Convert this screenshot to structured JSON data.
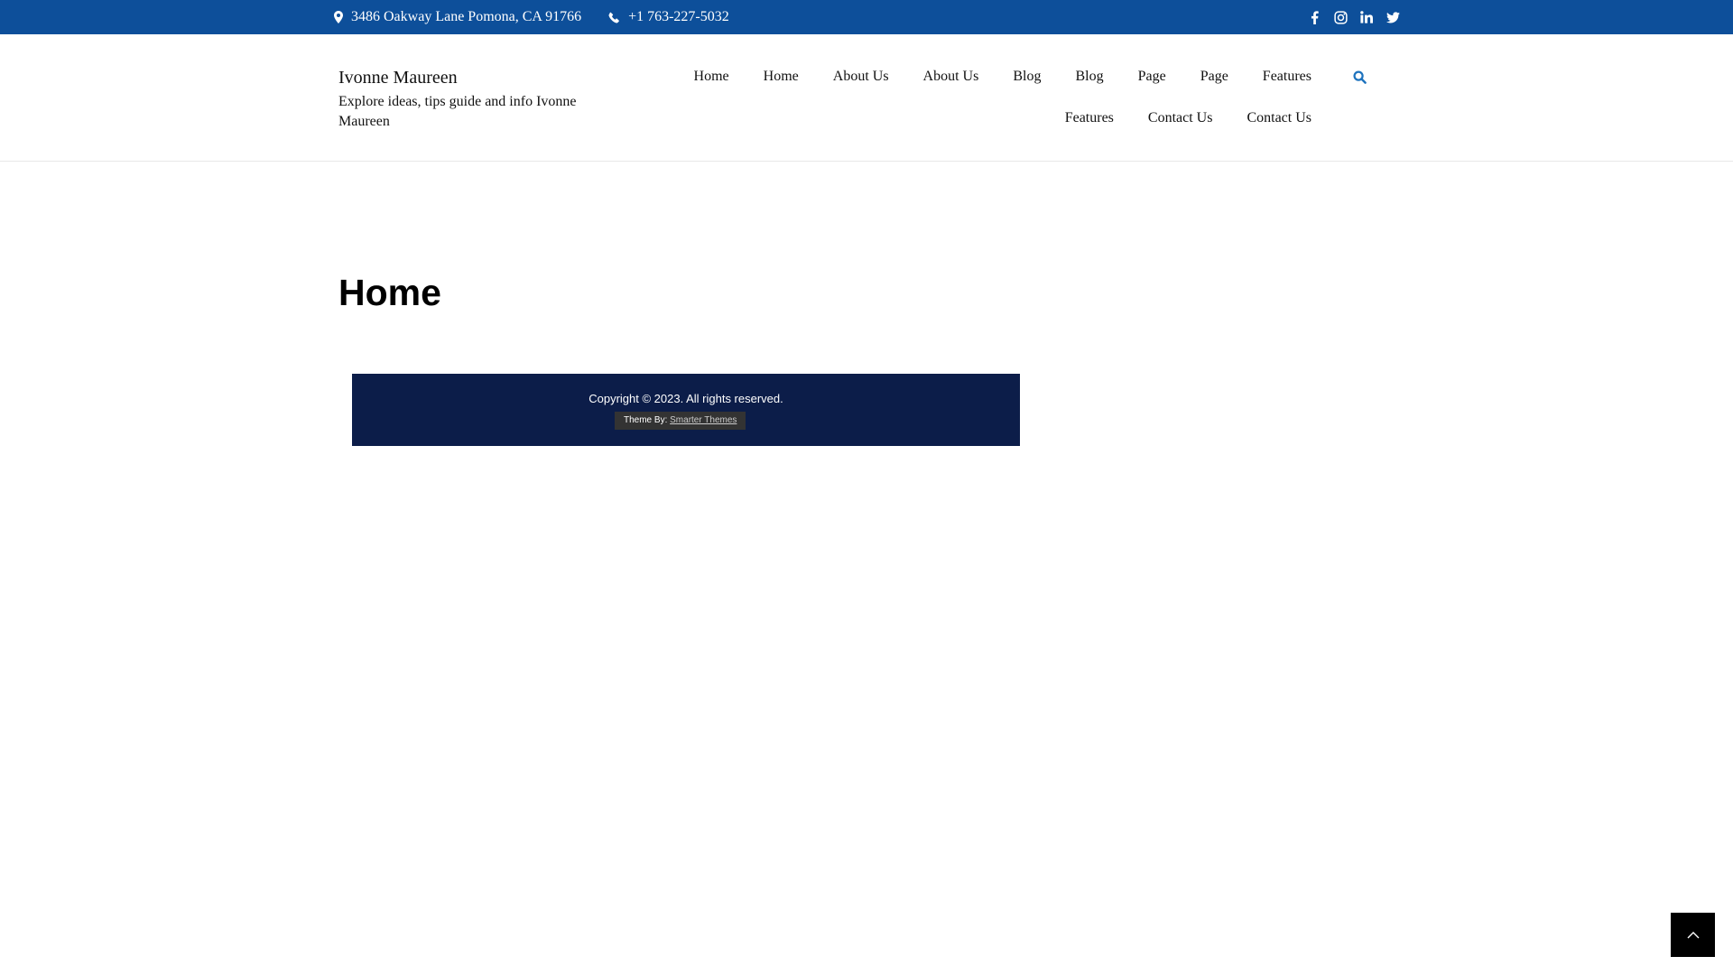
{
  "topbar": {
    "address": "3486 Oakway Lane Pomona, CA 91766",
    "phone": "+1 763-227-5032",
    "social": [
      "facebook-icon",
      "instagram-icon",
      "linkedin-icon",
      "twitter-icon"
    ]
  },
  "brand": {
    "title": "Ivonne Maureen",
    "tagline": "Explore ideas, tips guide and info Ivonne Maureen"
  },
  "nav": {
    "row1": [
      "Home",
      "Home",
      "About Us",
      "About Us",
      "Blog",
      "Blog",
      "Page",
      "Page",
      "Features"
    ],
    "row2": [
      "Features",
      "Contact Us",
      "Contact Us"
    ]
  },
  "main": {
    "title": "Home"
  },
  "footer": {
    "copyright": "Copyright © 2023. All rights reserved.",
    "credit_prefix": "Theme By:",
    "credit_link": "Smarter Themes"
  },
  "colors": {
    "topbar": "#0d4f9a",
    "footer": "#0c1d49",
    "accent": "#1e73be",
    "scroll_top": "#000000"
  }
}
